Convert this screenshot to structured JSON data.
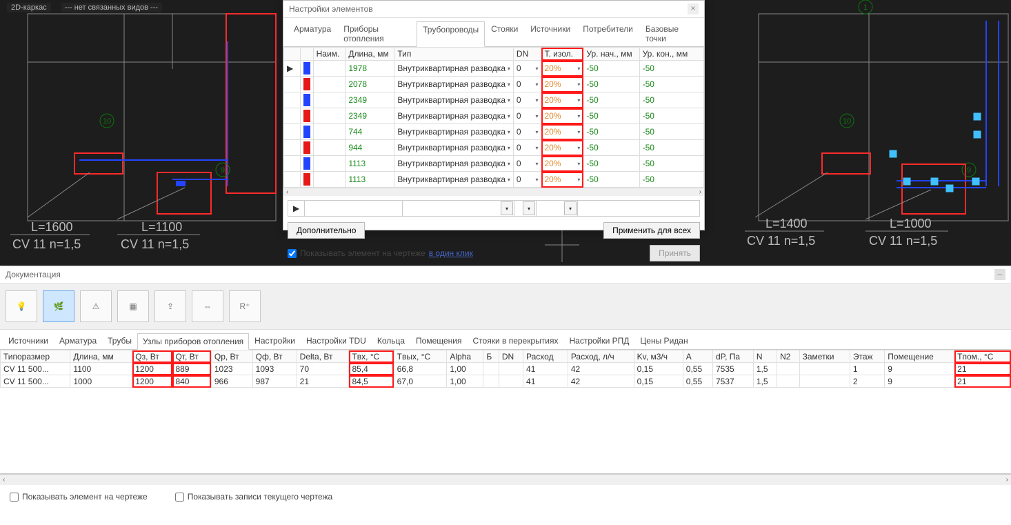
{
  "viewport": {
    "label_mode": "2D-каркас",
    "label_views": "--- нет связанных видов ---",
    "dims": [
      "L=1600",
      "CV 11 n=1,5",
      "L=1100",
      "CV 11 n=1,5",
      "L=1400",
      "CV 11 n=1,5",
      "L=1000",
      "CV 11 n=1,5"
    ],
    "rooms": [
      "10",
      "9",
      "1",
      "10",
      "9"
    ]
  },
  "dialog": {
    "title": "Настройки элементов",
    "tabs": [
      "Арматура",
      "Приборы отопления",
      "Трубопроводы",
      "Стояки",
      "Источники",
      "Потребители",
      "Базовые точки"
    ],
    "active_tab": 2,
    "columns": [
      {
        "key": "mark",
        "label": ""
      },
      {
        "key": "color",
        "label": ""
      },
      {
        "key": "naim",
        "label": "Наим."
      },
      {
        "key": "dlina",
        "label": "Длина, мм"
      },
      {
        "key": "tip",
        "label": "Тип"
      },
      {
        "key": "dn",
        "label": "DN"
      },
      {
        "key": "tizol",
        "label": "Т. изол."
      },
      {
        "key": "urnach",
        "label": "Ур. нач., мм"
      },
      {
        "key": "urkon",
        "label": "Ур. кон., мм"
      }
    ],
    "rows": [
      {
        "mark": "▶",
        "color": "#2244ff",
        "dlina": "1978",
        "tip": "Внутриквартирная разводка",
        "dn": "0",
        "tizol": "20%",
        "urnach": "-50",
        "urkon": "-50"
      },
      {
        "mark": "",
        "color": "#e61919",
        "dlina": "2078",
        "tip": "Внутриквартирная разводка",
        "dn": "0",
        "tizol": "20%",
        "urnach": "-50",
        "urkon": "-50"
      },
      {
        "mark": "",
        "color": "#2244ff",
        "dlina": "2349",
        "tip": "Внутриквартирная разводка",
        "dn": "0",
        "tizol": "20%",
        "urnach": "-50",
        "urkon": "-50"
      },
      {
        "mark": "",
        "color": "#e61919",
        "dlina": "2349",
        "tip": "Внутриквартирная разводка",
        "dn": "0",
        "tizol": "20%",
        "urnach": "-50",
        "urkon": "-50"
      },
      {
        "mark": "",
        "color": "#2244ff",
        "dlina": "744",
        "tip": "Внутриквартирная разводка",
        "dn": "0",
        "tizol": "20%",
        "urnach": "-50",
        "urkon": "-50"
      },
      {
        "mark": "",
        "color": "#e61919",
        "dlina": "944",
        "tip": "Внутриквартирная разводка",
        "dn": "0",
        "tizol": "20%",
        "urnach": "-50",
        "urkon": "-50"
      },
      {
        "mark": "",
        "color": "#2244ff",
        "dlina": "1113",
        "tip": "Внутриквартирная разводка",
        "dn": "0",
        "tizol": "20%",
        "urnach": "-50",
        "urkon": "-50"
      },
      {
        "mark": "",
        "color": "#e61919",
        "dlina": "1113",
        "tip": "Внутриквартирная разводка",
        "dn": "0",
        "tizol": "20%",
        "urnach": "-50",
        "urkon": "-50"
      }
    ],
    "btn_more": "Дополнительно",
    "btn_apply_all": "Применить для всех",
    "chk_show_drawing": "Показывать элемент на чертеже",
    "link_oneclick": "в один клик",
    "btn_accept": "Принять"
  },
  "doc_panel": {
    "title": "Документация",
    "toolbar_icons": [
      "bulb-icon",
      "tree-icon",
      "warn-page-icon",
      "grid-icon",
      "export-icon",
      "measure-icon",
      "revit-icon"
    ],
    "active_tool": 1,
    "tabs": [
      "Источники",
      "Арматура",
      "Трубы",
      "Узлы приборов отопления",
      "Настройки",
      "Настройки TDU",
      "Кольца",
      "Помещения",
      "Стояки в перекрытиях",
      "Настройки РПД",
      "Цены Ридан"
    ],
    "active_tab": 3,
    "columns": [
      "Типоразмер",
      "Длина, мм",
      "Qз, Вт",
      "Qт, Вт",
      "Qр, Вт",
      "Qф, Вт",
      "Delta, Вт",
      "Tвх, °C",
      "Tвых, °C",
      "Alpha",
      "Б",
      "DN",
      "Расход",
      "Расход, л/ч",
      "Kv, м3/ч",
      "A",
      "dP, Па",
      "N",
      "N2",
      "Заметки",
      "Этаж",
      "Помещение",
      "Tпом., °C"
    ],
    "rows": [
      {
        "c0": "CV 11 500...",
        "c1": "1100",
        "c2": "1200",
        "c3": "889",
        "c4": "1023",
        "c5": "1093",
        "c6": "70",
        "c7": "85,4",
        "c8": "66,8",
        "c9": "1,00",
        "c10": "",
        "c11": "",
        "c12": "41",
        "c13": "42",
        "c14": "0,15",
        "c15": "0,55",
        "c16": "7535",
        "c17": "1,5",
        "c18": "",
        "c19": "",
        "c20": "1",
        "c21": "9",
        "c22": "21"
      },
      {
        "c0": "CV 11 500...",
        "c1": "1000",
        "c2": "1200",
        "c3": "840",
        "c4": "966",
        "c5": "987",
        "c6": "21",
        "c7": "84,5",
        "c8": "67,0",
        "c9": "1,00",
        "c10": "",
        "c11": "",
        "c12": "41",
        "c13": "42",
        "c14": "0,15",
        "c15": "0,55",
        "c16": "7537",
        "c17": "1,5",
        "c18": "",
        "c19": "",
        "c20": "2",
        "c21": "9",
        "c22": "21"
      }
    ],
    "chk_show_drawing": "Показывать элемент на чертеже",
    "chk_show_records": "Показывать записи текущего чертежа",
    "highlight_cols_group1": [
      2,
      3
    ],
    "highlight_cols_group2": [
      7
    ],
    "highlight_cols_group3": [
      22
    ]
  }
}
